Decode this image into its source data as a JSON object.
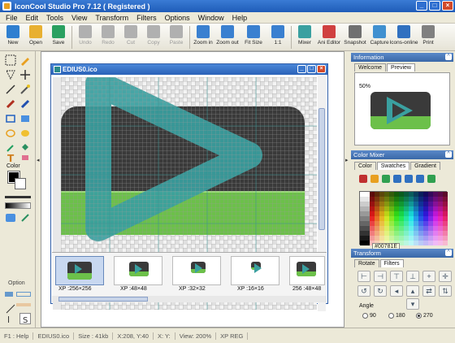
{
  "window": {
    "title": "IconCool Studio Pro 7.12 ( Registered )"
  },
  "menu": [
    "File",
    "Edit",
    "Tools",
    "View",
    "Transform",
    "Filters",
    "Options",
    "Window",
    "Help"
  ],
  "toolbar": [
    {
      "label": "New",
      "color": "#2f7fd0"
    },
    {
      "label": "Open",
      "color": "#e8b030"
    },
    {
      "label": "Save",
      "color": "#2aa060"
    },
    {
      "label": "Undo",
      "color": "#b0b0b0",
      "disabled": true
    },
    {
      "label": "Redo",
      "color": "#b0b0b0",
      "disabled": true
    },
    {
      "label": "Cut",
      "color": "#b0b0b0",
      "disabled": true
    },
    {
      "label": "Copy",
      "color": "#b0b0b0",
      "disabled": true
    },
    {
      "label": "Paste",
      "color": "#b0b0b0",
      "disabled": true
    },
    {
      "label": "Zoom in",
      "color": "#3a80d0"
    },
    {
      "label": "Zoom out",
      "color": "#3a80d0"
    },
    {
      "label": "Fit Size",
      "color": "#3a80d0"
    },
    {
      "label": "1:1",
      "color": "#3a80d0"
    },
    {
      "label": "Mixer",
      "color": "#3aa0a0"
    },
    {
      "label": "Ani Editor",
      "color": "#d04040"
    },
    {
      "label": "Snapshot",
      "color": "#707070"
    },
    {
      "label": "Capture",
      "color": "#4090d0"
    },
    {
      "label": "Icons-online",
      "color": "#3070c0"
    },
    {
      "label": "Print",
      "color": "#808080"
    }
  ],
  "left": {
    "color_label": "Color",
    "option_label": "Option"
  },
  "document": {
    "title": "EDIUS0.ico"
  },
  "thumbnails": [
    {
      "label": "XP :256×256",
      "selected": true
    },
    {
      "label": "XP :48×48"
    },
    {
      "label": "XP :32×32"
    },
    {
      "label": "XP :16×16"
    },
    {
      "label": "256 :48×48"
    }
  ],
  "right": {
    "information": {
      "title": "Information",
      "tabs": [
        "Welcome",
        "Preview"
      ],
      "zoom": "50%"
    },
    "color_mixer": {
      "title": "Color Mixer",
      "tabs": [
        "Color",
        "Swatches",
        "Gradient"
      ],
      "hex": "#00781E"
    },
    "transform": {
      "title": "Transform",
      "tabs": [
        "Rotate",
        "Filters"
      ],
      "angle_label": "Angle",
      "angles": [
        "90",
        "180",
        "270"
      ]
    }
  },
  "status": {
    "help": "F1 : Help",
    "file": "EDIUS0.ico",
    "size": "Size : 41kb",
    "cursor": "X:208, Y:40",
    "xy": "X: Y:",
    "view": "View: 200%",
    "format": "XP REG"
  },
  "colors": {
    "teal": "#3aa0a0",
    "green": "#6cc04a",
    "dark": "#3a3a3a"
  }
}
